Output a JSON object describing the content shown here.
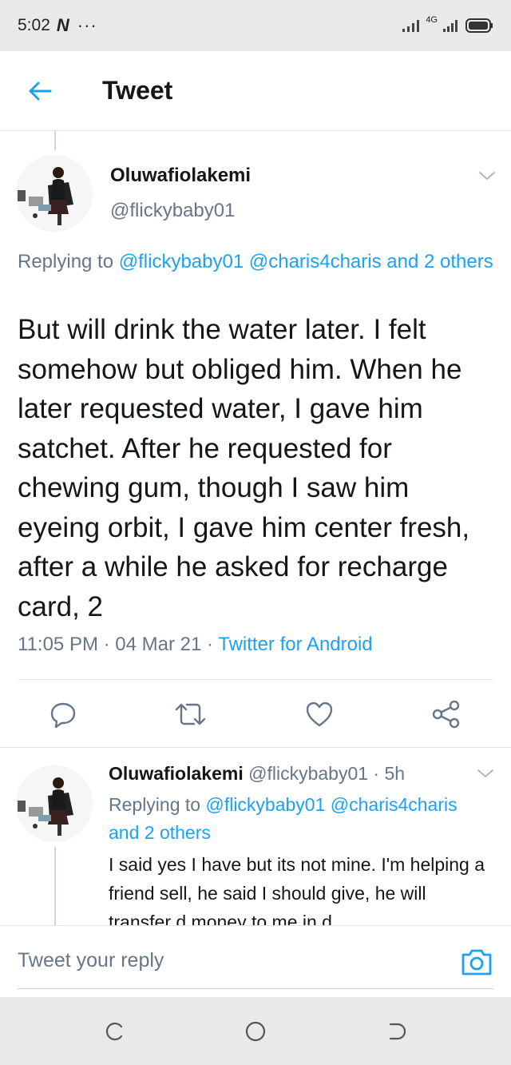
{
  "status_bar": {
    "time": "5:02",
    "app_badge": "N",
    "more": "···",
    "network": "4G"
  },
  "header": {
    "title": "Tweet"
  },
  "main_tweet": {
    "author_name": "Oluwafiolakemi",
    "handle": "@flickybaby01",
    "replying_prefix": "Replying to",
    "replying_mentions": "@flickybaby01 @charis4charis and 2 others",
    "text": "But will drink the water later. I felt somehow but obliged him. When he later requested water, I gave him satchet. After he requested for chewing gum, though I saw him eyeing orbit, I gave him center fresh, after a while he asked for recharge card, 2",
    "timestamp": "11:05 PM · 04 Mar 21 · ",
    "source": "Twitter for Android"
  },
  "reply_tweet": {
    "author_name": "Oluwafiolakemi",
    "handle_time": " @flickybaby01 · 5h",
    "replying_prefix": "Replying to",
    "replying_mentions": "@flickybaby01 @charis4charis and 2 others",
    "text": "I said yes I have but its not mine. I'm helping a friend sell, he said I should give, he will transfer d money to me in d"
  },
  "reply_bar": {
    "placeholder": "Tweet your reply"
  },
  "colors": {
    "accent": "#1da1f2",
    "secondary_text": "#657786",
    "primary_text": "#14171a",
    "divider": "#e1e8ed"
  },
  "icons": [
    "back-arrow-icon",
    "chevron-down-icon",
    "reply-icon",
    "retweet-icon",
    "like-icon",
    "share-icon",
    "camera-icon",
    "recent-apps-icon",
    "home-icon",
    "back-nav-icon"
  ]
}
